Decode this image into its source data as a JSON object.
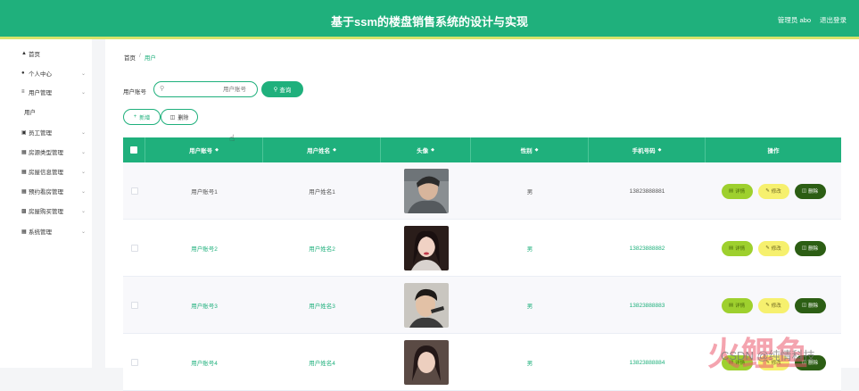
{
  "header": {
    "title": "基于ssm的楼盘销售系统的设计与实现",
    "user": "管理员 abo",
    "logout": "退出登录"
  },
  "sidebar": {
    "items": [
      {
        "icon": "home-icon",
        "label": "首页"
      },
      {
        "icon": "user-icon",
        "label": "个人中心"
      },
      {
        "icon": "menu-icon",
        "label": "用户管理"
      },
      {
        "icon": "none",
        "label": "用户"
      },
      {
        "icon": "briefcase-icon",
        "label": "员工管理"
      },
      {
        "icon": "grid-icon",
        "label": "房源类型管理"
      },
      {
        "icon": "grid-icon",
        "label": "房屋信息管理"
      },
      {
        "icon": "grid-icon",
        "label": "预约看房管理"
      },
      {
        "icon": "checkbox-icon",
        "label": "房屋购买管理"
      },
      {
        "icon": "grid-icon",
        "label": "系统管理"
      }
    ]
  },
  "breadcrumb": {
    "home": "首页",
    "separator": "/",
    "current": "用户"
  },
  "search": {
    "label": "用户账号",
    "placeholder": "用户账号",
    "button": "查询"
  },
  "actions": {
    "add": "新增",
    "delete": "删除"
  },
  "table": {
    "headers": {
      "account": "用户账号",
      "name": "用户姓名",
      "avatar": "头像",
      "gender": "性别",
      "phone": "手机号码",
      "ops": "操作"
    },
    "rows": [
      {
        "account": "用户账号1",
        "name": "用户姓名1",
        "gender": "男",
        "phone": "13823888881"
      },
      {
        "account": "用户账号2",
        "name": "用户姓名2",
        "gender": "男",
        "phone": "13823888882"
      },
      {
        "account": "用户账号3",
        "name": "用户姓名3",
        "gender": "男",
        "phone": "13823888883"
      },
      {
        "account": "用户账号4",
        "name": "用户姓名4",
        "gender": "男",
        "phone": "13823888884"
      }
    ],
    "op_labels": {
      "detail": "详情",
      "edit": "修改",
      "delete": "删除"
    }
  },
  "watermark": {
    "big": "火鲤鱼",
    "small": "CSDN @纯情科技"
  },
  "colors": {
    "primary": "#1fb07c",
    "accent_line": "#d9e36b",
    "detail": "#9ed02e",
    "edit": "#f6f06e",
    "delete": "#2c5e14"
  }
}
